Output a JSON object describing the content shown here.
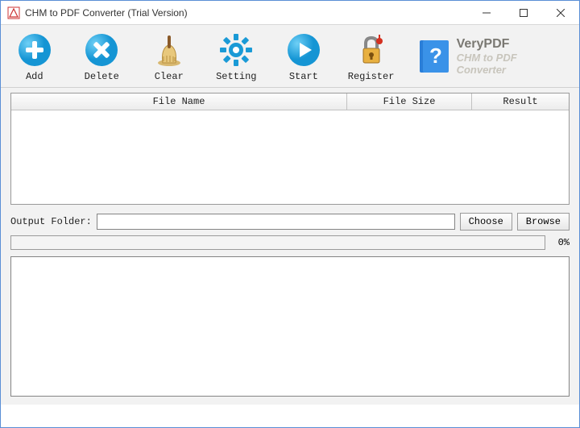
{
  "window": {
    "title": "CHM to PDF Converter (Trial Version)"
  },
  "toolbar": {
    "add": "Add",
    "delete": "Delete",
    "clear": "Clear",
    "setting": "Setting",
    "start": "Start",
    "register": "Register"
  },
  "brand": {
    "name": "VeryPDF",
    "sub": "CHM to PDF Converter"
  },
  "columns": {
    "filename": "File Name",
    "filesize": "File Size",
    "result": "Result"
  },
  "output": {
    "label": "Output Folder:",
    "value": "",
    "choose": "Choose",
    "browse": "Browse"
  },
  "progress": {
    "percent_label": "0%"
  }
}
